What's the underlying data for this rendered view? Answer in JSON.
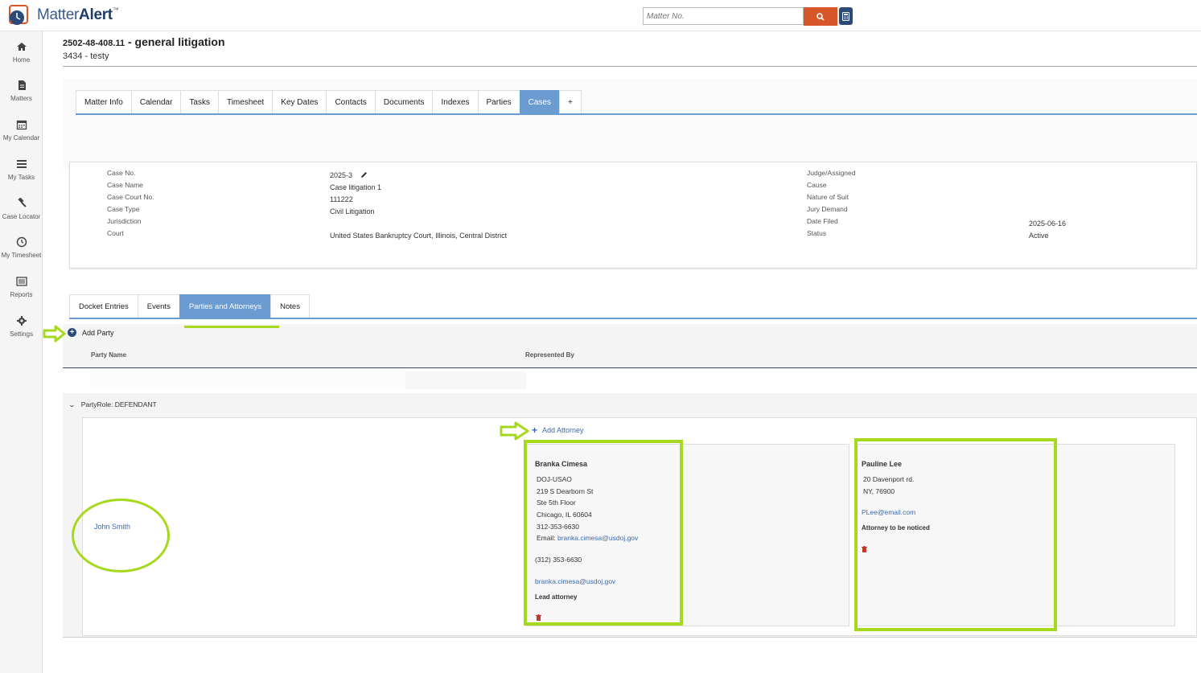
{
  "app": {
    "logo_text_light": "Matter",
    "logo_text_bold": "Alert",
    "logo_tm": "™"
  },
  "search": {
    "placeholder": "Matter No."
  },
  "sidebar": {
    "items": [
      {
        "label": "Home",
        "icon": "home-icon"
      },
      {
        "label": "Matters",
        "icon": "document-icon"
      },
      {
        "label": "My Calendar",
        "icon": "calendar-icon"
      },
      {
        "label": "My Tasks",
        "icon": "tasks-icon"
      },
      {
        "label": "Case Locator",
        "icon": "gavel-icon"
      },
      {
        "label": "My Timesheet",
        "icon": "clock-icon"
      },
      {
        "label": "Reports",
        "icon": "list-icon"
      },
      {
        "label": "Settings",
        "icon": "gear-icon"
      }
    ]
  },
  "matter": {
    "number": "2502-48-408.11",
    "title": " - general litigation",
    "subtitle": "3434 - testy"
  },
  "top_tabs": [
    "Matter Info",
    "Calendar",
    "Tasks",
    "Timesheet",
    "Key Dates",
    "Contacts",
    "Documents",
    "Indexes",
    "Parties",
    "Cases",
    "+"
  ],
  "top_tabs_active": "Cases",
  "case": {
    "labels_left": [
      "Case No.",
      "Case Name",
      "Case Court No.",
      "Case Type",
      "Jurisdiction",
      "Court"
    ],
    "case_no": "2025-3",
    "case_name": "Case litigation 1",
    "case_court_no": "111222",
    "case_type": "Civil Litigation",
    "court": "United States Bankruptcy Court, Illinois, Central District",
    "labels_right": [
      "Judge/Assigned",
      "Cause",
      "Nature of Suit",
      "Jury Demand",
      "Date Filed",
      "Status"
    ],
    "date_filed": "2025-06-16",
    "status": "Active"
  },
  "sub_tabs": [
    "Docket Entries",
    "Events",
    "Parties and Attorneys",
    "Notes"
  ],
  "sub_tabs_active": "Parties and Attorneys",
  "parties": {
    "add_party_label": "Add Party",
    "col_party_name": "Party Name",
    "col_represented_by": "Represented By",
    "role_label": "PartyRole: DEFENDANT",
    "party_name": "John Smith",
    "add_attorney_label": "Add Attorney",
    "attorneys": [
      {
        "name": "Branka Cimesa",
        "org": "DOJ-USAO",
        "addr1": "219 S Dearborn St",
        "addr2": "Ste 5th Floor",
        "city": "Chicago, IL 60604",
        "phone": "312-353-6630",
        "email_prefix": "Email: ",
        "email": "branka.cimesa@usdoj.gov",
        "phone2": "(312) 353-6630",
        "email2": "branka.cimesa@usdoj.gov",
        "role": "Lead attorney"
      },
      {
        "name": "Pauline Lee",
        "addr1": "20 Davenport rd.",
        "city": "NY, 76900",
        "email": "PLee@email.com",
        "role": "Attorney to be noticed"
      }
    ]
  },
  "colors": {
    "accent_blue": "#6a9bd1",
    "navy": "#2b4a78",
    "search_orange": "#d8572a",
    "highlight_green": "#a6d81e",
    "link_blue": "#3d6aa8"
  }
}
